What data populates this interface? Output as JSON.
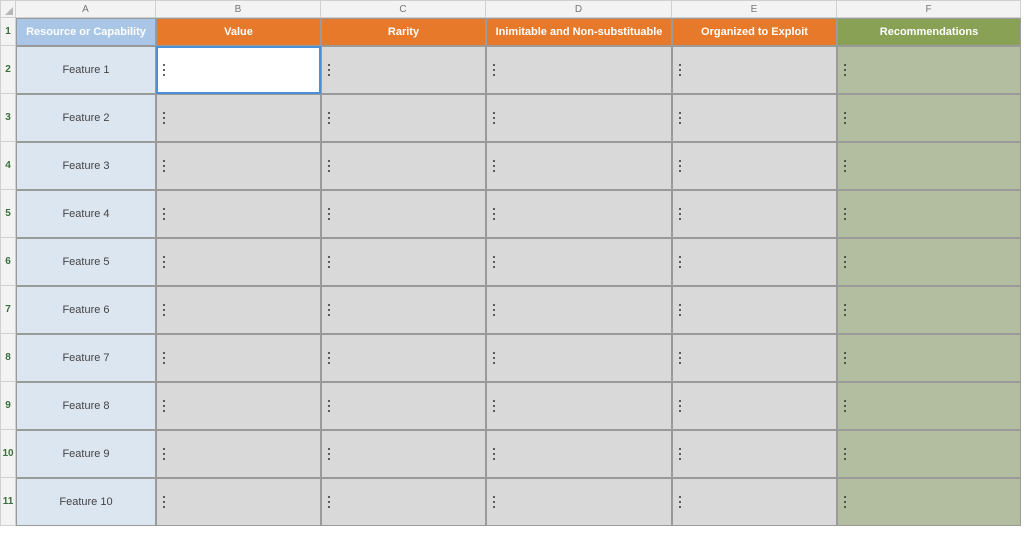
{
  "columns": [
    "A",
    "B",
    "C",
    "D",
    "E",
    "F"
  ],
  "header": {
    "A": "Resource or Capability",
    "B": "Value",
    "C": "Rarity",
    "D": "Inimitable and Non-substituable",
    "E": "Organized to Exploit",
    "F": "Recommendations"
  },
  "rows": [
    {
      "n": "2",
      "label": "Feature 1"
    },
    {
      "n": "3",
      "label": "Feature 2"
    },
    {
      "n": "4",
      "label": "Feature 3"
    },
    {
      "n": "5",
      "label": "Feature 4"
    },
    {
      "n": "6",
      "label": "Feature 5"
    },
    {
      "n": "7",
      "label": "Feature 6"
    },
    {
      "n": "8",
      "label": "Feature 7"
    },
    {
      "n": "9",
      "label": "Feature 8"
    },
    {
      "n": "10",
      "label": "Feature 9"
    },
    {
      "n": "11",
      "label": "Feature 10"
    }
  ],
  "selected_cell": "B2"
}
